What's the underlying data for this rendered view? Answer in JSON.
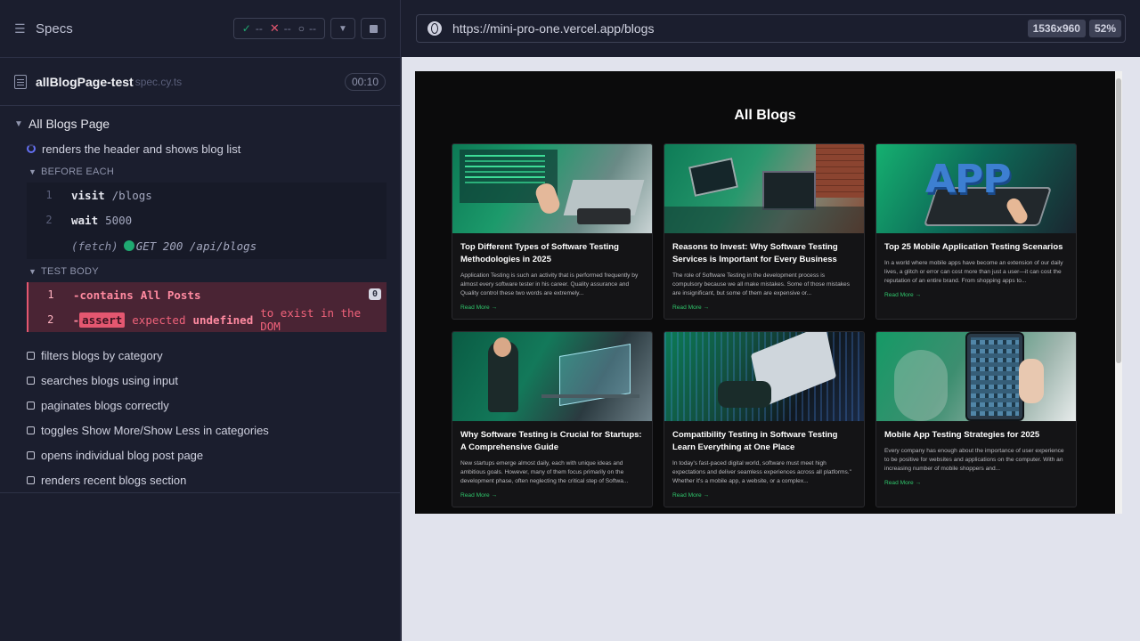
{
  "runner": {
    "specs_label": "Specs",
    "stats": {
      "passed": "--",
      "failed": "--",
      "pending": "--"
    },
    "file": {
      "name": "allBlogPage-test",
      "ext": "spec.cy.ts",
      "duration": "00:10"
    },
    "suite_title": "All Blogs Page",
    "running_test": "renders the header and shows blog list",
    "before_each": {
      "label": "BEFORE EACH",
      "commands": [
        {
          "num": "1",
          "name": "visit",
          "message": "/blogs"
        },
        {
          "num": "2",
          "name": "wait",
          "message": "5000"
        }
      ],
      "fetch": {
        "label": "(fetch)",
        "message": "GET 200 /api/blogs"
      }
    },
    "test_body": {
      "label": "TEST BODY",
      "commands": [
        {
          "num": "1",
          "name": "-contains",
          "message": "All Posts",
          "badge": "0"
        },
        {
          "num": "2",
          "prefix": "-",
          "name": "assert",
          "message_1": "expected",
          "message_2": "undefined",
          "message_3": "to exist in the DOM"
        }
      ]
    },
    "other_tests": [
      "filters blogs by category",
      "searches blogs using input",
      "paginates blogs correctly",
      "toggles Show More/Show Less in categories",
      "opens individual blog post page",
      "renders recent blogs section"
    ]
  },
  "aut": {
    "url": "https://mini-pro-one.vercel.app/blogs",
    "viewport": "1536x960",
    "scale": "52%",
    "page_title": "All Blogs",
    "cards": [
      {
        "title": "Top Different Types of Software Testing Methodologies in 2025",
        "excerpt": "Application Testing is such an activity that is performed frequently by almost every software tester in his career. Quality assurance and Quality control these two words are extremely...",
        "link": "Read More →",
        "image": "code-screens-hands"
      },
      {
        "title": "Reasons to Invest: Why Software Testing Services is Important for Every Business",
        "excerpt": "The role of Software Testing in the development process is compulsory because we all make mistakes. Some of those mistakes are insignificant, but some of them are expensive or...",
        "link": "Read More →",
        "image": "tablet-laptop-desk"
      },
      {
        "title": "Top 25 Mobile Application Testing Scenarios",
        "excerpt": "In a world where mobile apps have become an extension of our daily lives, a glitch or error can cost more than just a user—it can cost the reputation of an entire brand. From shopping apps to...",
        "link": "Read More →",
        "image": "app-tablet"
      },
      {
        "title": "Why Software Testing is Crucial for Startups: A Comprehensive Guide",
        "excerpt": "New startups emerge almost daily, each with unique ideas and ambitious goals. However, many of them focus primarily on the development phase, often neglecting the critical step of Softwa...",
        "link": "Read More →",
        "image": "woman-holographic-screen"
      },
      {
        "title": "Compatibility Testing in Software Testing Learn Everything at One Place",
        "excerpt": "In today's fast-paced digital world, software must meet high expectations and deliver seamless experiences across all platforms.\" Whether it's a mobile app, a website, or a complex...",
        "link": "Read More →",
        "image": "laptop-binary"
      },
      {
        "title": "Mobile App Testing Strategies for 2025",
        "excerpt": "Every company has enough about the importance of user experience to be positive for websites and applications on the computer. With an increasing number of mobile shoppers and...",
        "link": "Read More →",
        "image": "phone-apps"
      }
    ]
  },
  "colors": {
    "pass": "#1fa971",
    "fail": "#e45770",
    "running": "#6470f3",
    "link": "#2fc46a"
  }
}
